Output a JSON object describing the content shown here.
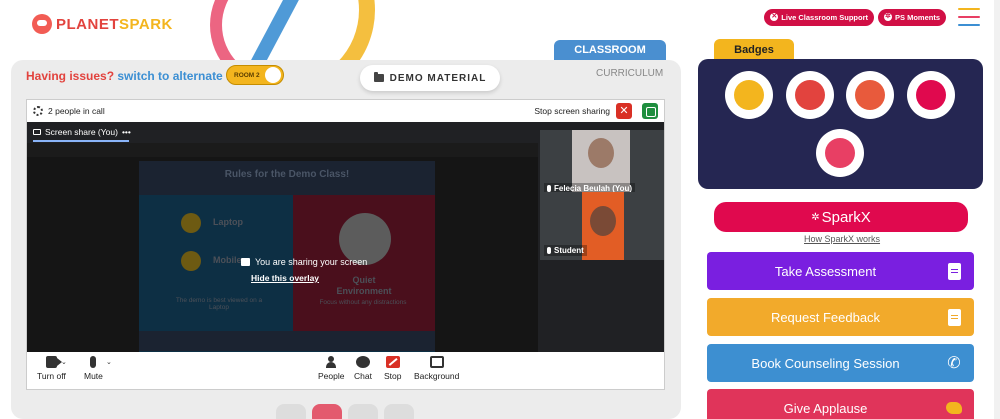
{
  "header": {
    "logo_text_a": "PLANET",
    "logo_text_b": "SPARK",
    "live_support_label": "Live Classroom Support",
    "ps_moments_label": "PS Moments"
  },
  "tabs": {
    "classroom": "CLASSROOM",
    "curriculum": "CURRICULUM"
  },
  "issues": {
    "text": "Having issues?",
    "link": "switch to alternate room",
    "room_toggle_label": "ROOM 2"
  },
  "demo_material_label": "DEMO MATERIAL",
  "meet": {
    "people_in_call": "2 people in call",
    "stop_sharing_label": "Stop screen sharing",
    "stop_x": "✕",
    "screen_share_label": "Screen share (You)",
    "more_dots": "•••",
    "overlay_text": "You are sharing your screen",
    "overlay_link": "Hide this overlay",
    "slide": {
      "title": "Rules for the Demo Class!",
      "laptop": "Laptop",
      "mobile": "Mobile",
      "quiet": "Quiet",
      "environment": "Environment",
      "left_note": "The demo is best viewed on a Laptop",
      "right_note": "Focus without any distractions"
    },
    "participants": [
      {
        "name": "Felecia Beulah (You)"
      },
      {
        "name": "Student"
      }
    ],
    "controls": {
      "turn_off": "Turn off",
      "mute": "Mute",
      "people": "People",
      "chat": "Chat",
      "stop": "Stop",
      "background": "Background",
      "caret": "⌄"
    }
  },
  "badges": {
    "title": "Badges",
    "items": [
      {
        "icon": "trophy-badge-icon",
        "color": "#f3b51e"
      },
      {
        "icon": "teamwork-badge-icon",
        "color": "#e2433e"
      },
      {
        "icon": "star-performer-badge-icon",
        "color": "#e85a3c"
      },
      {
        "icon": "idea-badge-icon",
        "color": "#e0094e"
      },
      {
        "icon": "glasses-badge-icon",
        "color": "#e83f64"
      }
    ]
  },
  "sparkx": {
    "spark_glyph": "✲",
    "label": "SparkX",
    "how_link": "How SparkX works"
  },
  "actions": [
    {
      "label": "Take Assessment",
      "color": "#7a1fe0",
      "icon": "clipboard-icon"
    },
    {
      "label": "Request Feedback",
      "color": "#f2aa2b",
      "icon": "document-icon"
    },
    {
      "label": "Book Counseling Session",
      "color": "#3d8fd1",
      "icon": "phone-icon"
    },
    {
      "label": "Give Applause",
      "color": "#e0345a",
      "icon": "clap-icon"
    }
  ],
  "colors": {
    "brand_red": "#e2433e",
    "brand_yellow": "#f3b51e",
    "brand_blue": "#3c8fd3",
    "hamburger": [
      "#f3b51e",
      "#e83f64",
      "#3c8fd3"
    ]
  }
}
